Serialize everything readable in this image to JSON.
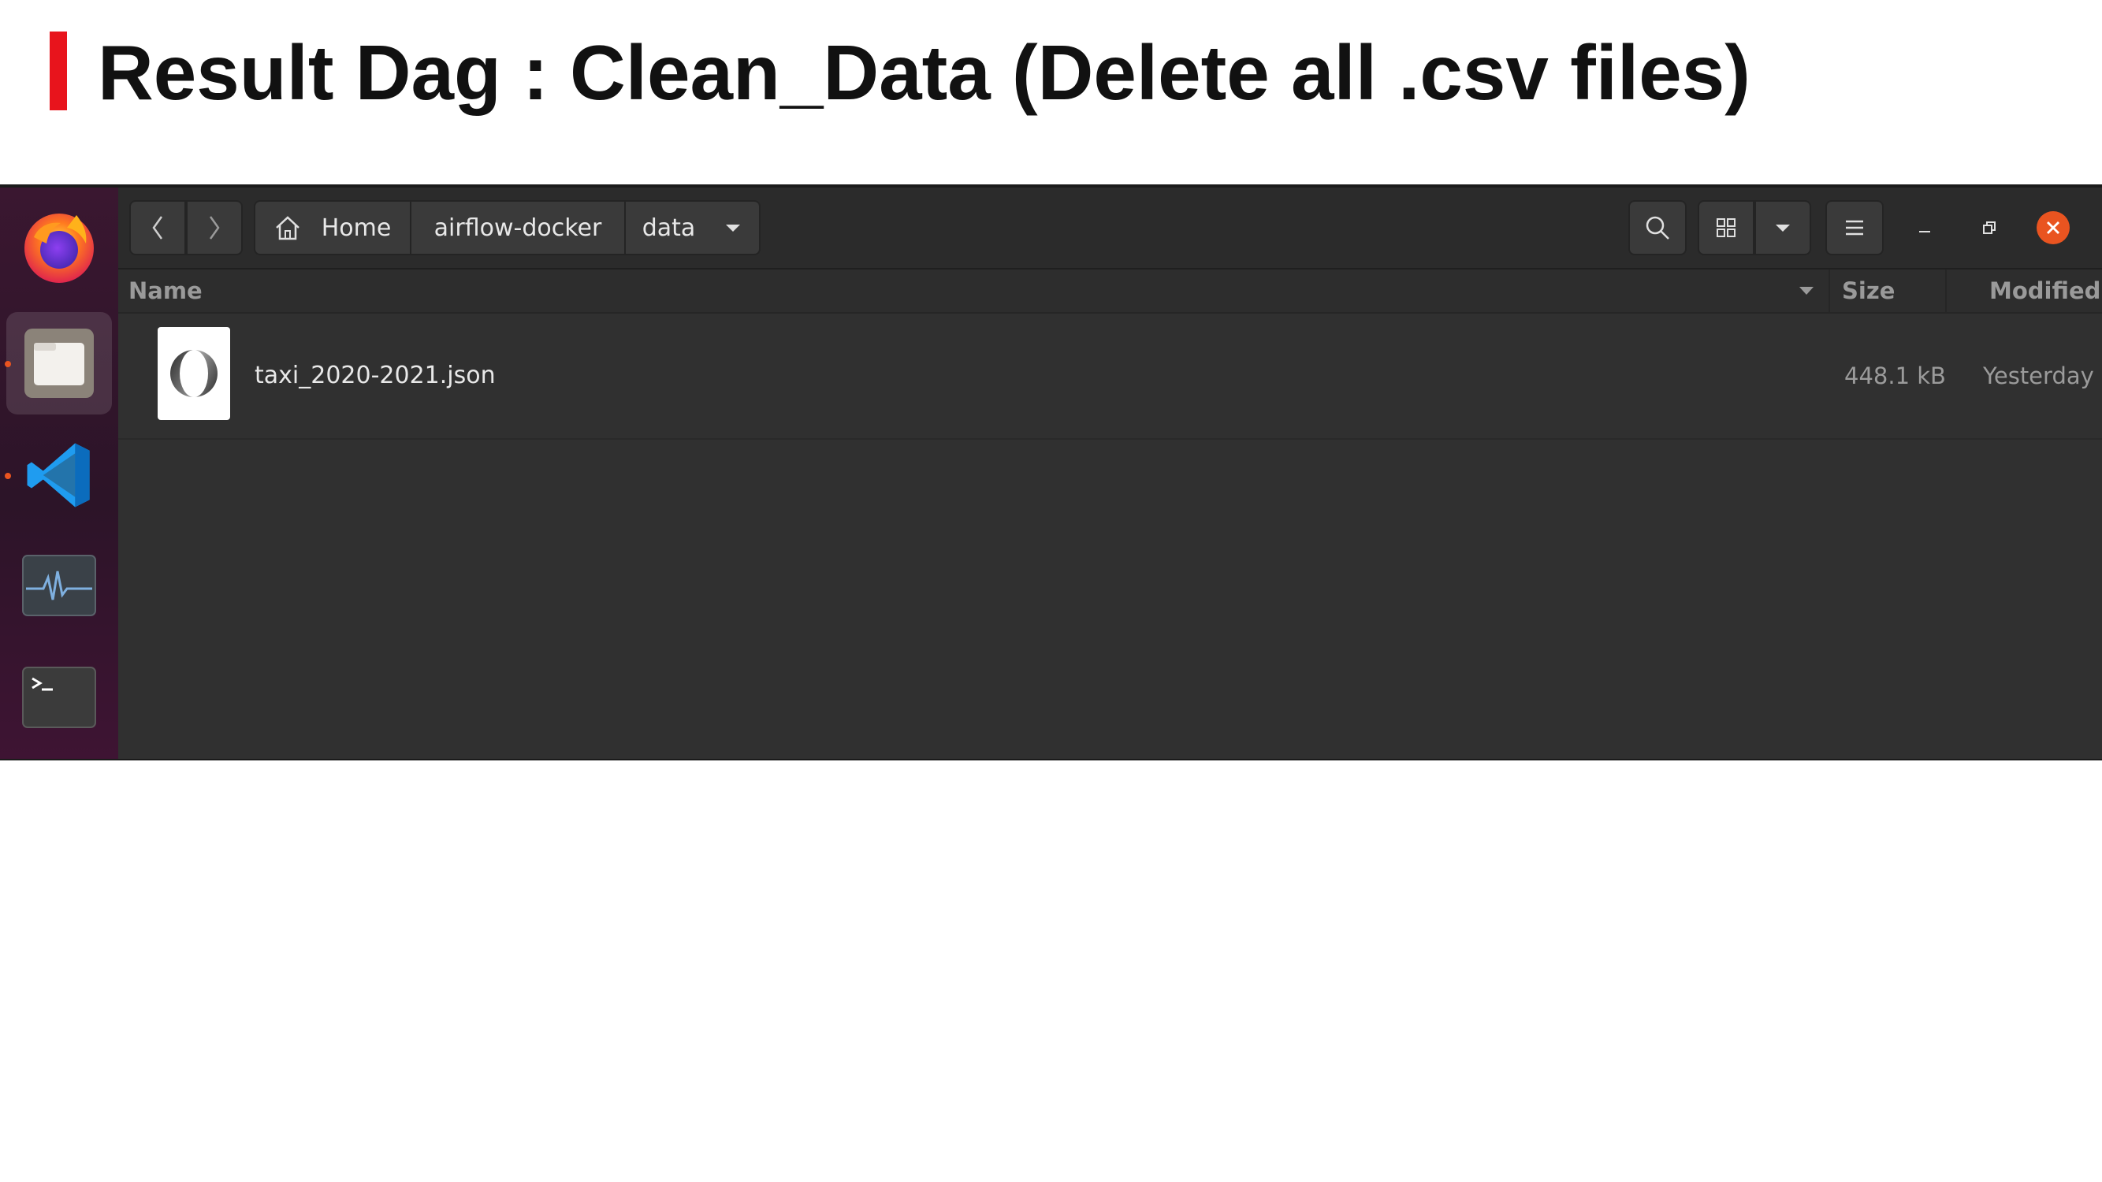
{
  "slide": {
    "title": "Result Dag : Clean_Data (Delete all .csv files)",
    "accent_color": "#e8141c"
  },
  "dock": {
    "items": [
      {
        "icon": "firefox-icon",
        "running": false
      },
      {
        "icon": "files-icon",
        "running": true,
        "active": true
      },
      {
        "icon": "vscode-icon",
        "running": true
      },
      {
        "icon": "system-monitor-icon",
        "running": false
      },
      {
        "icon": "terminal-icon",
        "running": false
      }
    ]
  },
  "toolbar": {
    "back_icon": "chevron-left-icon",
    "forward_icon": "chevron-right-icon",
    "breadcrumbs": [
      "Home",
      "airflow-docker",
      "data"
    ],
    "search_icon": "search-icon",
    "view_icon": "grid-view-icon",
    "view_options_icon": "chevron-down-icon",
    "menu_icon": "hamburger-menu-icon",
    "minimize_icon": "minimize-icon",
    "restore_icon": "restore-icon",
    "close_icon": "close-icon",
    "close_color": "#e95420"
  },
  "columns": {
    "name": "Name",
    "size": "Size",
    "modified": "Modified"
  },
  "files": [
    {
      "name": "taxi_2020-2021.json",
      "size": "448.1 kB",
      "modified": "Yesterday",
      "icon": "json-file-icon"
    }
  ]
}
